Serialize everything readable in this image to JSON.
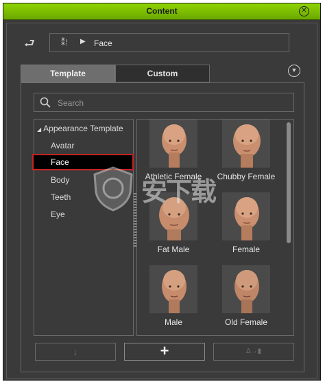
{
  "window": {
    "title": "Content"
  },
  "breadcrumb": {
    "current": "Face"
  },
  "tabs": [
    {
      "label": "Template"
    },
    {
      "label": "Custom"
    }
  ],
  "search": {
    "placeholder": "Search"
  },
  "tree": {
    "root": "Appearance Template",
    "items": [
      {
        "label": "Avatar"
      },
      {
        "label": "Face"
      },
      {
        "label": "Body"
      },
      {
        "label": "Teeth"
      },
      {
        "label": "Eye"
      }
    ],
    "selected": "Face"
  },
  "thumbnails": [
    {
      "label": "Athletic Female",
      "icon": "female-head-icon"
    },
    {
      "label": "Chubby Female",
      "icon": "female-head-icon"
    },
    {
      "label": "Fat Male",
      "icon": "male-head-icon"
    },
    {
      "label": "Female",
      "icon": "female-head-icon"
    },
    {
      "label": "Male",
      "icon": "male-head-icon"
    },
    {
      "label": "Old Female",
      "icon": "female-head-icon"
    }
  ],
  "buttons": {
    "down": "↓",
    "add": "+",
    "replace": "Δ→▮"
  },
  "watermark": {
    "text": "安下载"
  },
  "colors": {
    "titlebar": "#7cc000",
    "selection_border": "#c62222",
    "panel_bg": "#3a3a3a"
  }
}
